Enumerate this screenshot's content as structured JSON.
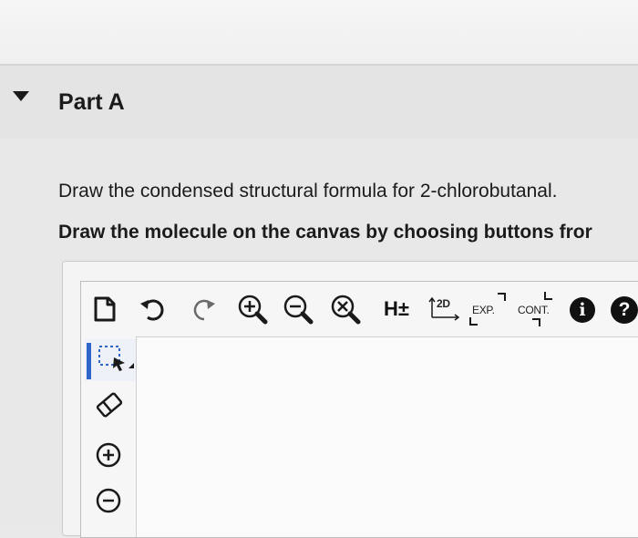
{
  "part": {
    "title": "Part A"
  },
  "question": {
    "text": "Draw the condensed structural formula for 2-chlorobutanal.",
    "instruction": "Draw the molecule on the canvas by choosing buttons fror"
  },
  "toolbar": {
    "hydrogen_label": "H±",
    "clean2d_label": "2D",
    "expand_label": "EXP.",
    "contract_label": "CONT.",
    "info_label": "i",
    "help_label": "?"
  },
  "colors": {
    "selected_accent": "#2f67c9",
    "icon": "#1a1a1a"
  },
  "icons": [
    "disclosure-triangle-icon",
    "new-document-icon",
    "undo-icon",
    "redo-icon",
    "zoom-in-icon",
    "zoom-out-icon",
    "clear-icon",
    "select-lasso-icon",
    "eraser-icon",
    "positive-charge-icon",
    "negative-charge-icon"
  ]
}
